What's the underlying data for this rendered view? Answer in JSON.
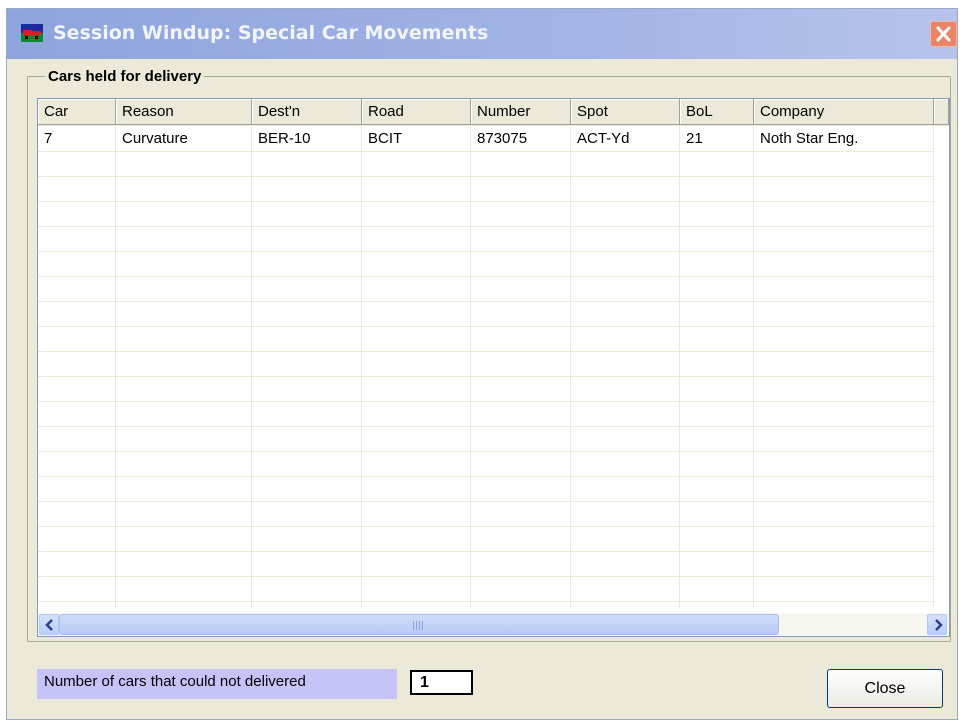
{
  "window": {
    "title": "Session Windup: Special Car Movements",
    "icons": {
      "app": "app-icon",
      "close": "close-icon"
    }
  },
  "group": {
    "label": "Cars held for delivery"
  },
  "table": {
    "columns": [
      "Car",
      "Reason",
      "Dest'n",
      "Road",
      "Number",
      "Spot",
      "BoL",
      "Company"
    ],
    "rows": [
      [
        "7",
        "Curvature",
        "BER-10",
        "BCIT",
        "873075",
        "ACT-Yd",
        "21",
        "Noth Star Eng."
      ]
    ]
  },
  "scrollbar": {
    "left_icon": "chevron-left-icon",
    "right_icon": "chevron-right-icon",
    "grip_icon": "grip-icon"
  },
  "footer": {
    "count_label": "Number of cars that could not delivered",
    "count_value": "1",
    "close_label": "Close"
  },
  "colors": {
    "title_gradient_start": "#8ea4dc",
    "close_button_red": "#e98566",
    "count_label_bg": "#c6c3f8",
    "dialog_bg": "#ece9d8"
  }
}
